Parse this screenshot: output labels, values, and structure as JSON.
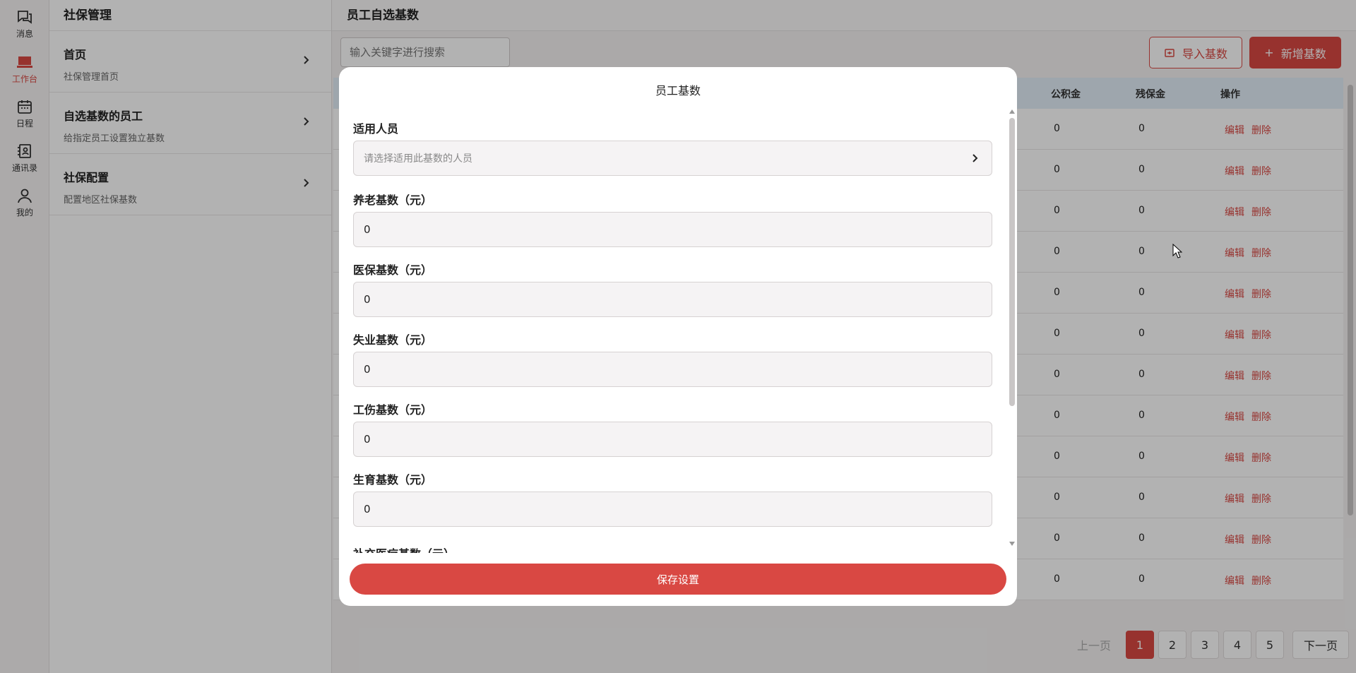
{
  "rail": {
    "items": [
      {
        "label": "消息",
        "icon": "message-icon"
      },
      {
        "label": "工作台",
        "icon": "laptop-icon",
        "active": true
      },
      {
        "label": "日程",
        "icon": "calendar-icon"
      },
      {
        "label": "通讯录",
        "icon": "contacts-icon"
      },
      {
        "label": "我的",
        "icon": "user-icon"
      }
    ]
  },
  "subnav": {
    "title": "社保管理",
    "items": [
      {
        "title": "首页",
        "subtitle": "社保管理首页"
      },
      {
        "title": "自选基数的员工",
        "subtitle": "给指定员工设置独立基数"
      },
      {
        "title": "社保配置",
        "subtitle": "配置地区社保基数"
      }
    ]
  },
  "main": {
    "title": "员工自选基数",
    "search_placeholder": "输入关键字进行搜索",
    "import_label": "导入基数",
    "add_label": "新增基数",
    "columns": [
      "公积金",
      "残保金",
      "操作"
    ],
    "rows": [
      {
        "fund": "0",
        "disability": "0"
      },
      {
        "fund": "0",
        "disability": "0"
      },
      {
        "fund": "0",
        "disability": "0"
      },
      {
        "fund": "0",
        "disability": "0"
      },
      {
        "fund": "0",
        "disability": "0"
      },
      {
        "fund": "0",
        "disability": "0"
      },
      {
        "fund": "0",
        "disability": "0"
      },
      {
        "fund": "0",
        "disability": "0"
      },
      {
        "fund": "0",
        "disability": "0"
      },
      {
        "fund": "0",
        "disability": "0"
      },
      {
        "fund": "0",
        "disability": "0"
      },
      {
        "fund": "0",
        "disability": "0"
      }
    ],
    "edit_label": "编辑",
    "delete_label": "删除",
    "pagination": {
      "prev": "上一页",
      "pages": [
        "1",
        "2",
        "3",
        "4",
        "5"
      ],
      "current": "1",
      "next": "下一页"
    }
  },
  "modal": {
    "title": "员工基数",
    "fields": [
      {
        "label": "适用人员",
        "placeholder": "请选择适用此基数的人员",
        "type": "select"
      },
      {
        "label": "养老基数（元）",
        "value": "0"
      },
      {
        "label": "医保基数（元）",
        "value": "0"
      },
      {
        "label": "失业基数（元）",
        "value": "0"
      },
      {
        "label": "工伤基数（元）",
        "value": "0"
      },
      {
        "label": "生育基数（元）",
        "value": "0"
      },
      {
        "label": "补充医疗基数（元）",
        "value": ""
      }
    ],
    "save_label": "保存设置"
  },
  "colors": {
    "accent": "#d94843",
    "table_header": "#e3eef8"
  }
}
